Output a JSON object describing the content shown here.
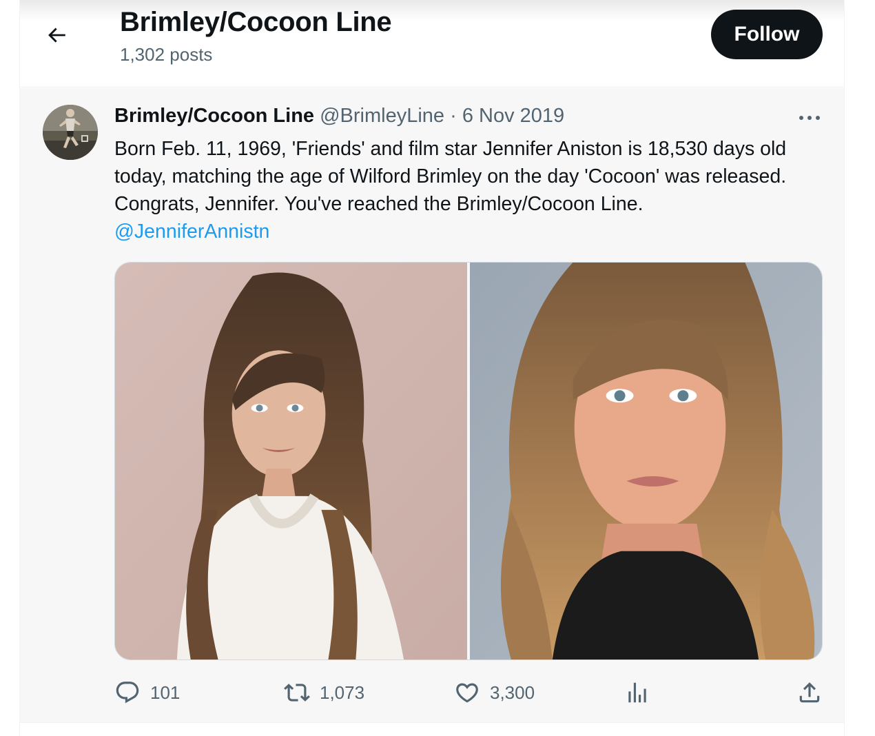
{
  "header": {
    "title": "Brimley/Cocoon Line",
    "post_count": "1,302 posts",
    "follow_label": "Follow",
    "back_icon": "arrow-left-icon"
  },
  "tweet": {
    "author_name": "Brimley/Cocoon Line",
    "author_handle": "@BrimleyLine",
    "separator": "·",
    "date": "6 Nov 2019",
    "text": "Born Feb. 11, 1969, 'Friends' and film star Jennifer Aniston is 18,530 days old today, matching the age of Wilford Brimley on the day 'Cocoon' was released. Congrats, Jennifer. You've reached the Brimley/Cocoon Line.",
    "mention": "@JenniferAnnistn",
    "media_count": 2,
    "more_icon": "more-horizontal-icon"
  },
  "actions": {
    "replies": "101",
    "reposts": "1,073",
    "likes": "3,300",
    "icons": [
      "reply-icon",
      "repost-icon",
      "like-icon",
      "views-icon",
      "share-icon"
    ]
  },
  "colors": {
    "text_primary": "#0f1419",
    "text_secondary": "#536471",
    "link": "#1d9bf0",
    "follow_bg": "#0f1419",
    "tweet_bg": "#f7f7f7"
  }
}
